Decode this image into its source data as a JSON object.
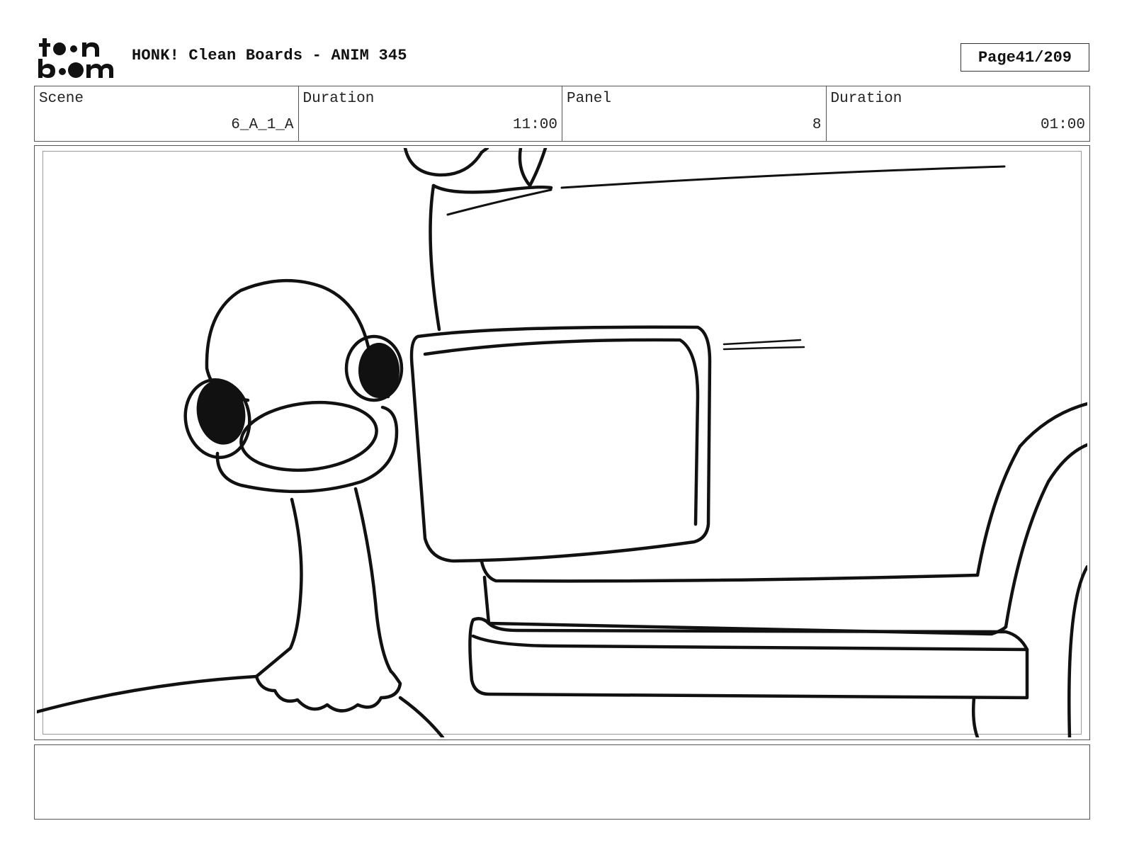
{
  "header": {
    "logo_text": "toon boom",
    "title": "HONK! Clean Boards - ANIM 345",
    "page_label": "Page",
    "page_number": "41/209"
  },
  "info": {
    "scene_label": "Scene",
    "scene_value": "6_A_1_A",
    "scene_duration_label": "Duration",
    "scene_duration_value": "11:00",
    "panel_label": "Panel",
    "panel_value": "8",
    "panel_duration_label": "Duration",
    "panel_duration_value": "01:00"
  },
  "notes": {
    "text": ""
  }
}
